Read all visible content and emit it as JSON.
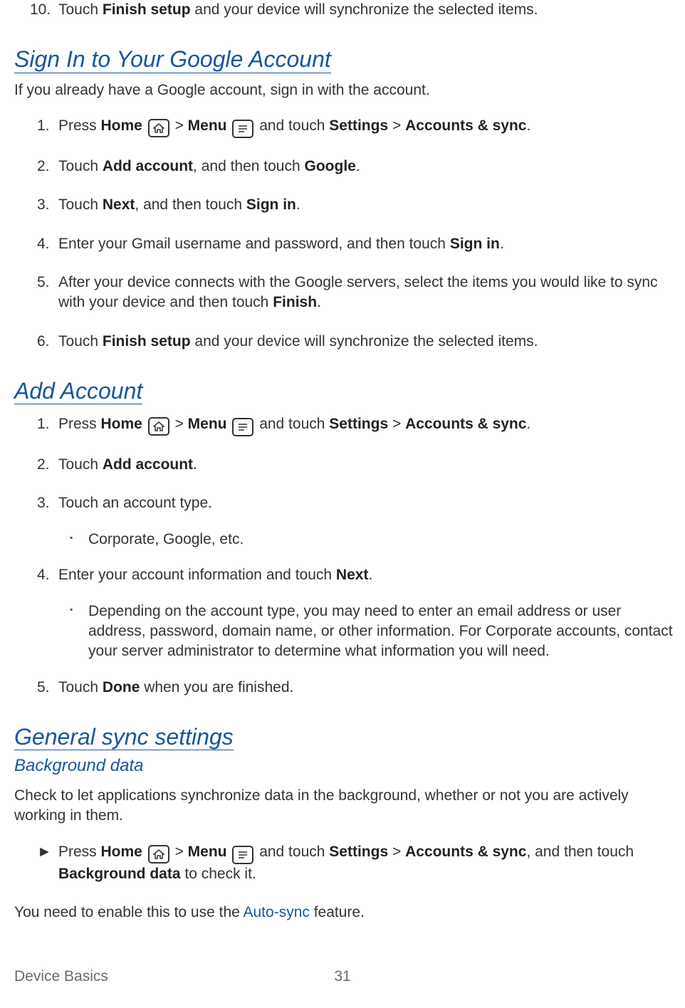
{
  "pre_step10": {
    "idx": "10.",
    "t1": "Touch ",
    "b1": "Finish setup",
    "t2": " and your device will synchronize the selected items."
  },
  "h_signin": "Sign In to Your Google Account",
  "signin_intro": "If you already have a Google account, sign in with the account.",
  "signin_steps": {
    "s1": {
      "idx": "1.",
      "t1": "Press ",
      "b1": "Home",
      "gt1": " > ",
      "b2": "Menu",
      "t2": " and touch ",
      "b3": "Settings",
      "gt2": " > ",
      "b4": "Accounts & sync",
      "t3": "."
    },
    "s2": {
      "idx": "2.",
      "t1": "Touch ",
      "b1": "Add account",
      "t2": ", and then touch ",
      "b2": "Google",
      "t3": "."
    },
    "s3": {
      "idx": "3.",
      "t1": "Touch ",
      "b1": "Next",
      "t2": ", and then touch ",
      "b2": "Sign in",
      "t3": "."
    },
    "s4": {
      "idx": "4.",
      "t1": "Enter your Gmail username and password, and then touch ",
      "b1": "Sign in",
      "t2": "."
    },
    "s5": {
      "idx": "5.",
      "t1": "After your device connects with the Google servers, select the items you would like to sync with your device and then touch ",
      "b1": "Finish",
      "t2": "."
    },
    "s6": {
      "idx": "6.",
      "t1": "Touch ",
      "b1": "Finish setup",
      "t2": " and your device will synchronize the selected items."
    }
  },
  "h_addacct": "Add Account",
  "addacct_steps": {
    "s1": {
      "idx": "1.",
      "t1": "Press ",
      "b1": "Home",
      "gt1": " > ",
      "b2": "Menu",
      "t2": " and touch ",
      "b3": "Settings",
      "gt2": " > ",
      "b4": "Accounts & sync",
      "t3": "."
    },
    "s2": {
      "idx": "2.",
      "t1": "Touch ",
      "b1": "Add account",
      "t2": "."
    },
    "s3": {
      "idx": "3.",
      "t1": "Touch an account type."
    },
    "s3b": "Corporate, Google, etc.",
    "s4": {
      "idx": "4.",
      "t1": "Enter your account information and touch ",
      "b1": "Next",
      "t2": "."
    },
    "s4b": "Depending on the account type, you may need to enter an email address or user address, password, domain name, or other information. For Corporate accounts, contact your server administrator to determine what information you will need.",
    "s5": {
      "idx": "5.",
      "t1": "Touch ",
      "b1": "Done",
      "t2": " when you are finished."
    }
  },
  "h_general": "General sync settings",
  "h_bgdata": "Background data",
  "bgdata_text": "Check to let applications synchronize data in the background, whether or not you are actively working in them.",
  "bgdata_step": {
    "arrow": "►",
    "t1": "Press ",
    "b1": "Home",
    "gt1": " > ",
    "b2": "Menu",
    "t2": " and touch ",
    "b3": "Settings",
    "gt2": " > ",
    "b4": "Accounts & sync",
    "t3": ", and then touch ",
    "b5": "Background data",
    "t4": " to check it."
  },
  "autosync_text": {
    "t1": "You need to enable this to use the ",
    "link": "Auto-sync",
    "t2": " feature."
  },
  "footer": {
    "section": "Device Basics",
    "page": "31"
  }
}
